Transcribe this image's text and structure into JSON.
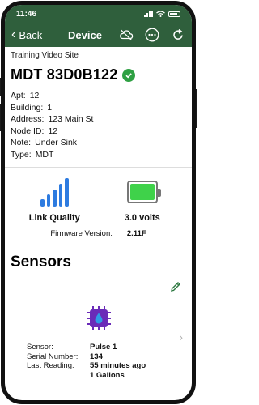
{
  "statusbar": {
    "time": "11:46"
  },
  "nav": {
    "back_label": "Back",
    "title": "Device"
  },
  "site_name": "Training Video Site",
  "device": {
    "title": "MDT 83D0B122",
    "details": [
      {
        "label": "Apt:",
        "value": "12"
      },
      {
        "label": "Building:",
        "value": "1"
      },
      {
        "label": "Address:",
        "value": "123 Main St"
      },
      {
        "label": "Node ID:",
        "value": "12"
      },
      {
        "label": "Note:",
        "value": "Under Sink"
      },
      {
        "label": "Type:",
        "value": "MDT"
      }
    ]
  },
  "status": {
    "link_quality_label": "Link Quality",
    "link_quality_level": 1.0,
    "battery_label": "3.0 volts",
    "battery_level": 1.0,
    "firmware_label": "Firmware Version:",
    "firmware_value": "2.11F"
  },
  "sensors": {
    "title": "Sensors",
    "items": [
      {
        "sensor_label": "Sensor:",
        "sensor_value": "Pulse 1",
        "serial_label": "Serial Number:",
        "serial_value": "134",
        "reading_label": "Last Reading:",
        "reading_time": "55 minutes ago",
        "reading_value": "1  Gallons"
      }
    ]
  },
  "colors": {
    "header_green": "#2f5f3c",
    "check_green": "#2ea043",
    "link_blue": "#2d7be0",
    "battery_green": "#3fd24a",
    "chip_purple": "#6a2bb8"
  }
}
